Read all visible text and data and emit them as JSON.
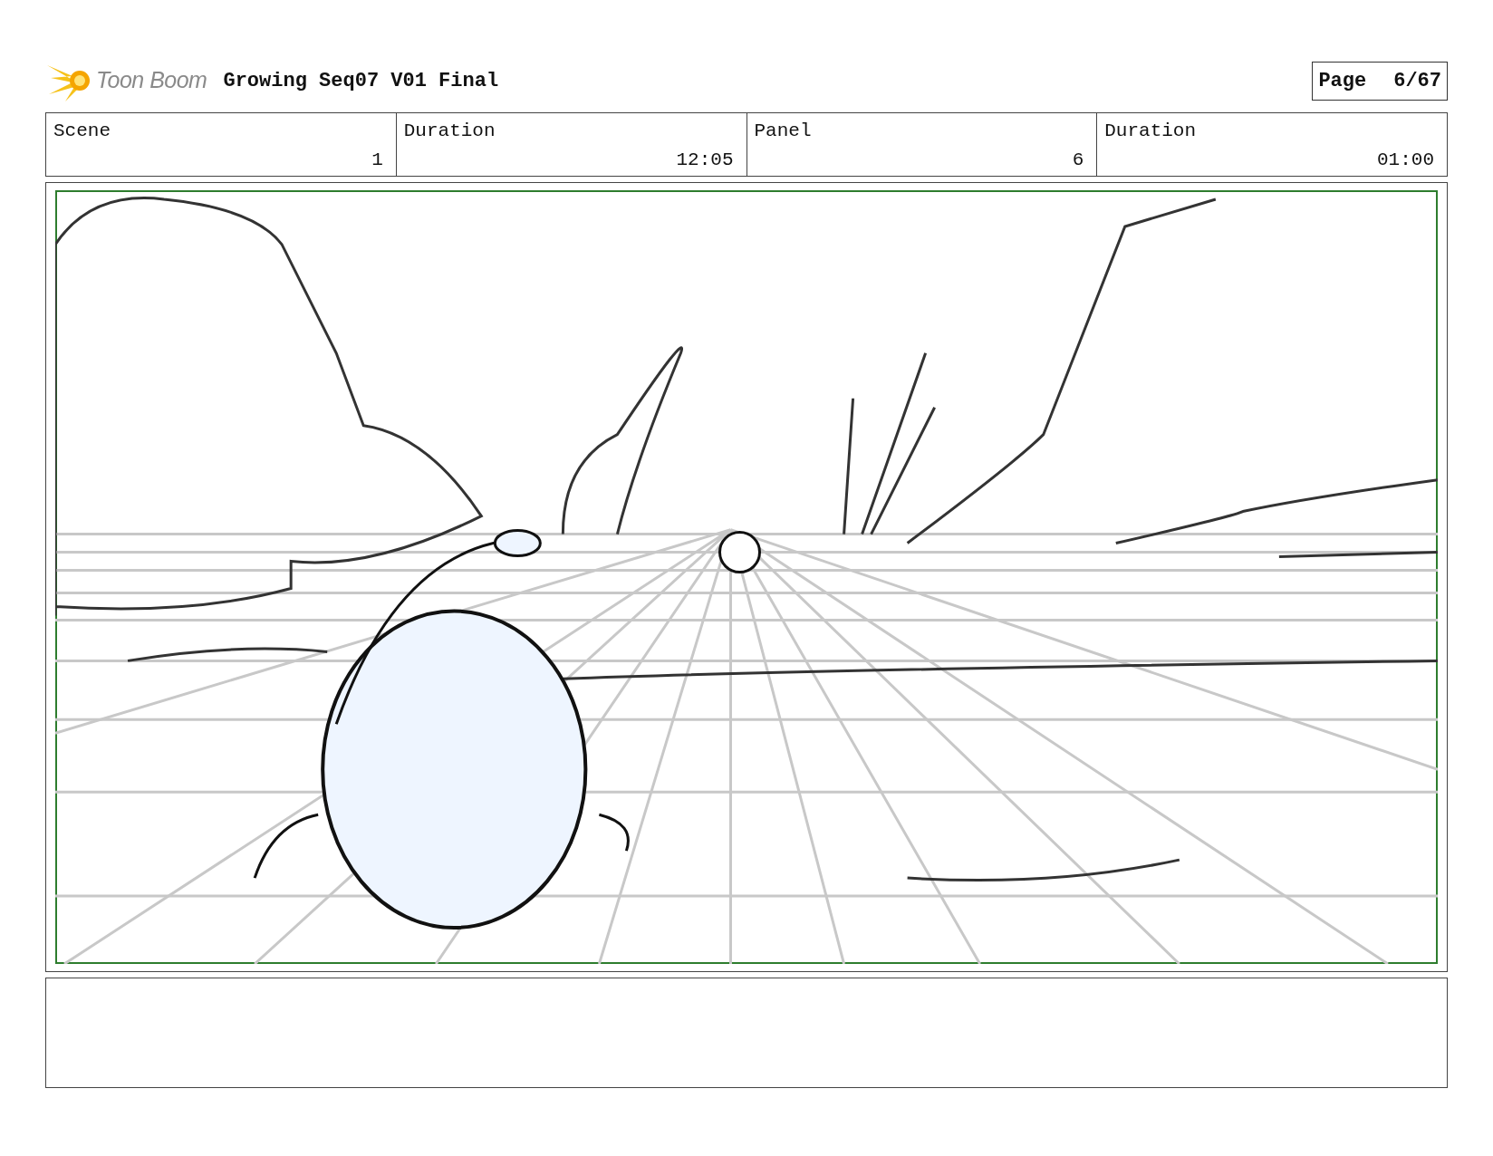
{
  "header": {
    "logo_text": "Toon Boom",
    "title": "Growing Seq07 V01 Final",
    "page_label": "Page",
    "page_value": "6/67"
  },
  "fields": [
    {
      "label": "Scene",
      "value": "1"
    },
    {
      "label": "Duration",
      "value": "12:05"
    },
    {
      "label": "Panel",
      "value": "6"
    },
    {
      "label": "Duration",
      "value": "01:00"
    }
  ]
}
